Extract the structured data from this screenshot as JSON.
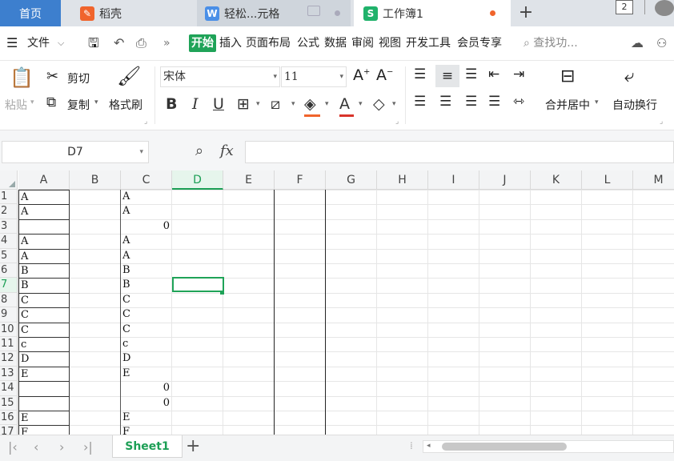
{
  "tabs": {
    "home": "首页",
    "daoke": "稻壳",
    "word_doc": "轻松...元格",
    "workbook": "工作簿1",
    "window_count": "2"
  },
  "menu": {
    "file": "文件",
    "items": [
      "开始",
      "插入",
      "页面布局",
      "公式",
      "数据",
      "审阅",
      "视图",
      "开发工具",
      "会员专享"
    ],
    "search_placeholder": "查找功..."
  },
  "ribbon": {
    "paste": "粘贴",
    "cut": "剪切",
    "copy": "复制",
    "format_painter": "格式刷",
    "font_name": "宋体",
    "font_size": "11",
    "merge_center": "合并居中",
    "wrap_text": "自动换行"
  },
  "formula_bar": {
    "cell_ref": "D7",
    "fx_label": "fx",
    "content": ""
  },
  "grid": {
    "columns": [
      "A",
      "B",
      "C",
      "D",
      "E",
      "F",
      "G",
      "H",
      "I",
      "J",
      "K",
      "L",
      "M"
    ],
    "selected_column": "D",
    "selected_row": 7,
    "rows": [
      {
        "n": "1",
        "a": "A",
        "c": "A",
        "c_num": ""
      },
      {
        "n": "2",
        "a": "A",
        "c": "A",
        "c_num": ""
      },
      {
        "n": "3",
        "a": "",
        "c": "",
        "c_num": "0"
      },
      {
        "n": "4",
        "a": "A",
        "c": "A",
        "c_num": ""
      },
      {
        "n": "5",
        "a": "A",
        "c": "A",
        "c_num": ""
      },
      {
        "n": "6",
        "a": "B",
        "c": "B",
        "c_num": ""
      },
      {
        "n": "7",
        "a": "B",
        "c": "B",
        "c_num": ""
      },
      {
        "n": "8",
        "a": "C",
        "c": "C",
        "c_num": ""
      },
      {
        "n": "9",
        "a": "C",
        "c": "C",
        "c_num": ""
      },
      {
        "n": "10",
        "a": "C",
        "c": "C",
        "c_num": ""
      },
      {
        "n": "11",
        "a": "c",
        "c": "c",
        "c_num": ""
      },
      {
        "n": "12",
        "a": "D",
        "c": "D",
        "c_num": ""
      },
      {
        "n": "13",
        "a": "E",
        "c": "E",
        "c_num": ""
      },
      {
        "n": "14",
        "a": "",
        "c": "",
        "c_num": "0"
      },
      {
        "n": "15",
        "a": "",
        "c": "",
        "c_num": "0"
      },
      {
        "n": "16",
        "a": "E",
        "c": "E",
        "c_num": ""
      },
      {
        "n": "17",
        "a": "F",
        "c": "F",
        "c_num": ""
      }
    ]
  },
  "sheets": {
    "active": "Sheet1"
  },
  "colors": {
    "accent": "#1fa358",
    "home_tab": "#3d7fce",
    "modified_dot": "#f0642c"
  }
}
